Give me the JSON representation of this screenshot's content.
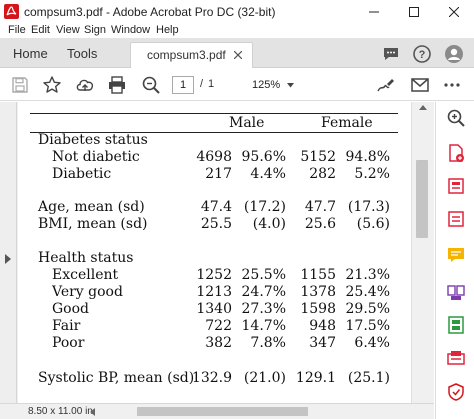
{
  "window": {
    "title": "compsum3.pdf - Adobe Acrobat Pro DC (32-bit)"
  },
  "menu": [
    "File",
    "Edit",
    "View",
    "Sign",
    "Window",
    "Help"
  ],
  "tabs": {
    "home": "Home",
    "tools": "Tools",
    "document": "compsum3.pdf"
  },
  "toolbar": {
    "page_current": "1",
    "page_separator": "/",
    "page_total": "1",
    "zoom": "125%"
  },
  "status": {
    "page_size": "8.50 x 11.00 in"
  },
  "table": {
    "header_male": "Male",
    "header_female": "Female",
    "diabetes_group": "Diabetes status",
    "rows_diabetes": [
      {
        "label": "Not diabetic",
        "m_n": "4698",
        "m_p": "95.6%",
        "f_n": "5152",
        "f_p": "94.8%"
      },
      {
        "label": "Diabetic",
        "m_n": "217",
        "m_p": "4.4%",
        "f_n": "282",
        "f_p": "5.2%"
      }
    ],
    "rows_age_bmi": [
      {
        "label": "Age, mean (sd)",
        "m_n": "47.4",
        "m_p": "(17.2)",
        "f_n": "47.7",
        "f_p": "(17.3)"
      },
      {
        "label": "BMI, mean (sd)",
        "m_n": "25.5",
        "m_p": "(4.0)",
        "f_n": "25.6",
        "f_p": "(5.6)"
      }
    ],
    "health_group": "Health status",
    "rows_health": [
      {
        "label": "Excellent",
        "m_n": "1252",
        "m_p": "25.5%",
        "f_n": "1155",
        "f_p": "21.3%"
      },
      {
        "label": "Very good",
        "m_n": "1213",
        "m_p": "24.7%",
        "f_n": "1378",
        "f_p": "25.4%"
      },
      {
        "label": "Good",
        "m_n": "1340",
        "m_p": "27.3%",
        "f_n": "1598",
        "f_p": "29.5%"
      },
      {
        "label": "Fair",
        "m_n": "722",
        "m_p": "14.7%",
        "f_n": "948",
        "f_p": "17.5%"
      },
      {
        "label": "Poor",
        "m_n": "382",
        "m_p": "7.8%",
        "f_n": "347",
        "f_p": "6.4%"
      }
    ],
    "rows_bp": [
      {
        "label": "Systolic BP, mean (sd)",
        "m_n": "132.9",
        "m_p": "(21.0)",
        "f_n": "129.1",
        "f_p": "(25.1)"
      }
    ]
  },
  "icons": {
    "toolbar": [
      "save-icon",
      "bookmark-star-icon",
      "upload-cloud-icon",
      "print-icon",
      "zoom-search-icon",
      "page-up-icon",
      "page-down-icon",
      "cursor-icon",
      "hand-icon",
      "zoom-out-icon",
      "zoom-in-icon",
      "sign-pen-icon",
      "email-icon",
      "more-icon"
    ],
    "right_panel": [
      "search-icon",
      "create-pdf-icon",
      "edit-pdf-icon",
      "export-pdf-icon",
      "comment-icon",
      "combine-files-icon",
      "organize-pages-icon",
      "scan-icon",
      "protect-icon"
    ]
  },
  "colors": {
    "acrobat_red": "#d4161c",
    "accent_blue": "#1473e6"
  }
}
